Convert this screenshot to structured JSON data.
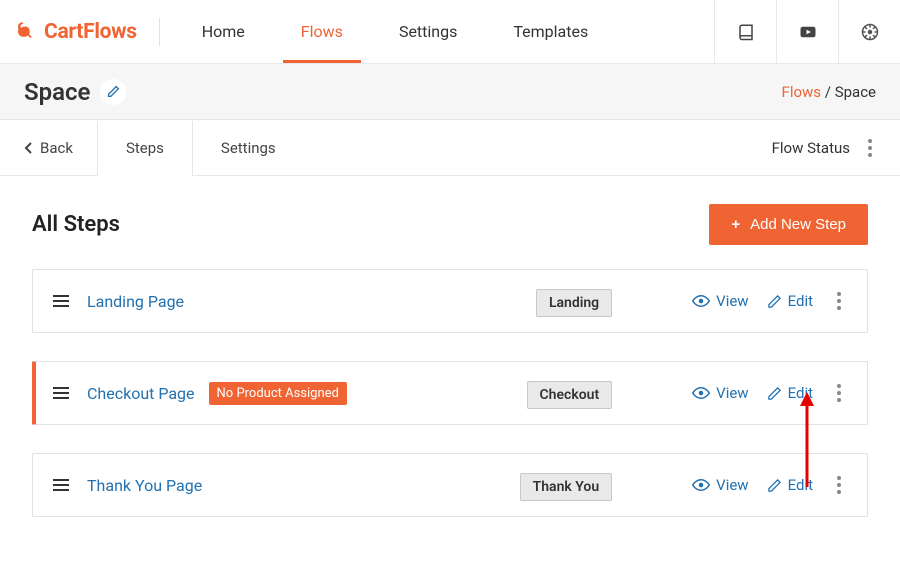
{
  "brand": {
    "name": "CartFlows"
  },
  "nav": {
    "home": "Home",
    "flows": "Flows",
    "settings": "Settings",
    "templates": "Templates"
  },
  "page": {
    "title": "Space",
    "breadcrumb_parent": "Flows",
    "breadcrumb_current": "Space"
  },
  "tabs": {
    "back": "Back",
    "steps": "Steps",
    "settings": "Settings",
    "flow_status": "Flow Status"
  },
  "list": {
    "heading": "All Steps",
    "add_button": "Add New Step",
    "view_label": "View",
    "edit_label": "Edit",
    "no_product_badge": "No Product Assigned",
    "steps": [
      {
        "name": "Landing Page",
        "type": "Landing",
        "highlight": false,
        "warn": false
      },
      {
        "name": "Checkout Page",
        "type": "Checkout",
        "highlight": true,
        "warn": true
      },
      {
        "name": "Thank You Page",
        "type": "Thank You",
        "highlight": false,
        "warn": false
      }
    ]
  }
}
